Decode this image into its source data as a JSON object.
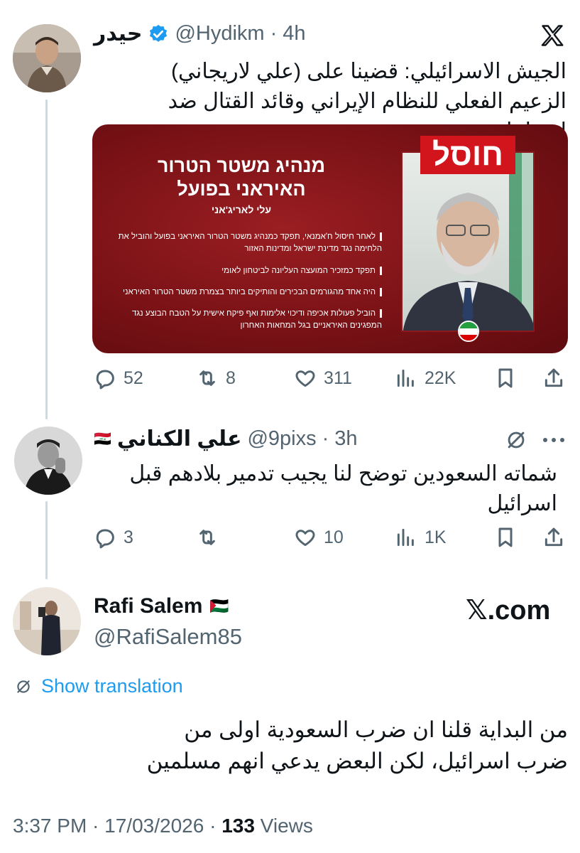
{
  "main_tweet": {
    "name": "حيدر",
    "handle": "@Hydikm",
    "time": "· 4h",
    "text": "الجيش الاسرائيلي: قضينا على (علي لاريجاني) الزعيم الفعلي للنظام الإيراني وقائد القتال ضد إسرائيل.",
    "media": {
      "badge": "חוסל",
      "headline": "מנהיג משטר הטרור האיראני בפועל",
      "subtitle": "עלי לאריג'אני",
      "bullets": [
        "לאחר חיסול ח'אמנאי, תפקד כמנהיג משטר הטרור האיראני בפועל והוביל את הלחימה נגד מדינת ישראל ומדינות האזור",
        "תפקד כמזכיר המועצה העליונה לביטחון לאומי",
        "היה אחד מהגורמים הבכירים והותיקים ביותר בצמרת משטר הטרור האיראני",
        "הוביל פעולות אכיפה ודיכוי אלימות ואף פיקח אישית על הטבח הבוצע נגד המפגינים האיראניים בגל המחאות האחרון"
      ]
    },
    "stats": {
      "replies": "52",
      "reposts": "8",
      "likes": "311",
      "views": "22K"
    }
  },
  "reply_tweet": {
    "name": "علي الكناني",
    "flag": "🇮🇶",
    "handle": "@9pixs",
    "time": "· 3h",
    "text": "شماته السعودين توضح لنا يجيب تدمير بلادهم قبل اسرائيل",
    "stats": {
      "replies": "3",
      "reposts": "",
      "likes": "10",
      "views": "1K"
    }
  },
  "quote_tweet": {
    "name": "Rafi Salem",
    "flag": "🇵🇸",
    "handle": "@RafiSalem85",
    "watermark": "𝕏.com",
    "show_translation": "Show translation",
    "text": "من البداية قلنا ان ضرب السعودية اولى من ضرب اسرائيل، لكن البعض يدعي انهم مسلمين",
    "footer_time": "3:37 PM · 17/03/2026 · ",
    "footer_views_count": "133",
    "footer_views_label": " Views"
  },
  "colors": {
    "accent": "#1d9bf0",
    "secondary_text": "#536471",
    "media_bg": "#7a1216",
    "badge": "#d2141c"
  },
  "icons": [
    "x-logo-icon",
    "verified-badge-icon",
    "reply-icon",
    "repost-icon",
    "like-icon",
    "views-icon",
    "bookmark-icon",
    "share-icon",
    "more-icon",
    "translate-icon"
  ]
}
